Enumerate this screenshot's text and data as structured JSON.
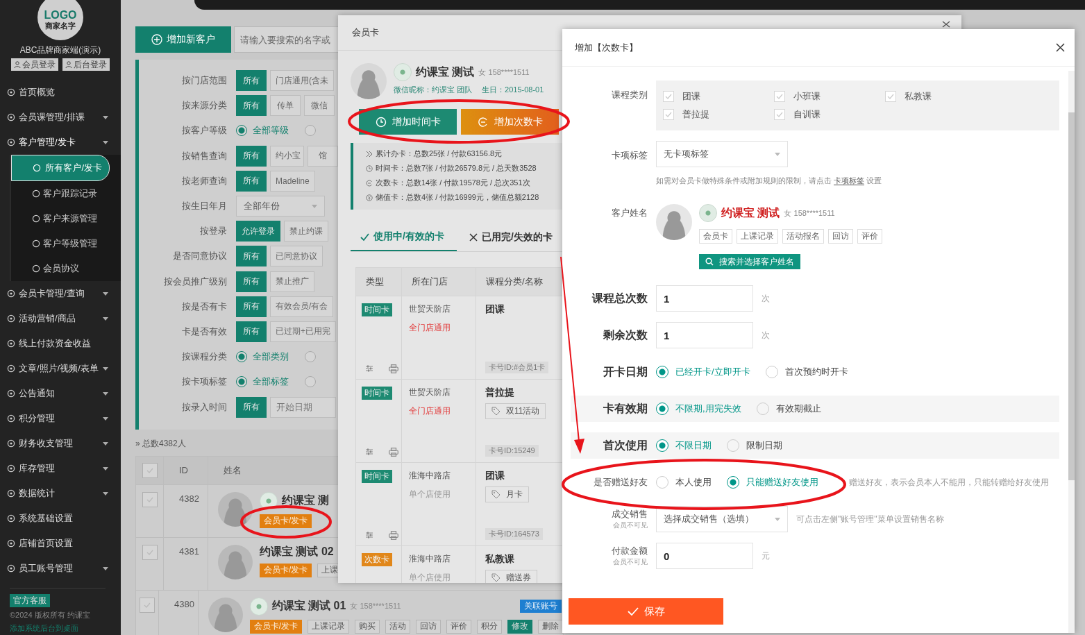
{
  "sidebar": {
    "logo_title": "LOGO",
    "logo_subtitle": "商家名字",
    "brand": "ABC品牌商家端(演示)",
    "login_buttons": [
      "会员登录",
      "后台登录"
    ],
    "items": [
      {
        "label": "首页概览",
        "kind": "link"
      },
      {
        "label": "会员课管理/排课",
        "kind": "group",
        "expanded": false
      },
      {
        "label": "客户管理/发卡",
        "kind": "group",
        "expanded": true,
        "children": [
          {
            "label": "所有客户/发卡",
            "selected": true
          },
          {
            "label": "客户跟踪记录",
            "selected": false
          },
          {
            "label": "客户来源管理",
            "selected": false
          },
          {
            "label": "客户等级管理",
            "selected": false
          },
          {
            "label": "会员协议",
            "selected": false
          }
        ]
      },
      {
        "label": "会员卡管理/查询",
        "kind": "group",
        "expanded": false
      },
      {
        "label": "活动营销/商品",
        "kind": "group",
        "expanded": false
      },
      {
        "label": "线上付款资金收益",
        "kind": "link"
      },
      {
        "label": "文章/照片/视频/表单",
        "kind": "group",
        "expanded": false
      },
      {
        "label": "公告通知",
        "kind": "group",
        "expanded": false
      },
      {
        "label": "积分管理",
        "kind": "group",
        "expanded": false
      },
      {
        "label": "财务收支管理",
        "kind": "group",
        "expanded": false
      },
      {
        "label": "库存管理",
        "kind": "group",
        "expanded": false
      },
      {
        "label": "数据统计",
        "kind": "group",
        "expanded": false
      },
      {
        "label": "系统基础设置",
        "kind": "link"
      },
      {
        "label": "店铺首页设置",
        "kind": "link"
      },
      {
        "label": "员工账号管理",
        "kind": "group",
        "expanded": false
      }
    ],
    "support_badge": "官方客服",
    "copyright": "©2024 版权所有 约课宝",
    "desktop_link": "添加系统后台到桌面"
  },
  "toolbar": {
    "add_button": "增加新客户",
    "search": {
      "placeholder": "请输入要搜索的名字或"
    }
  },
  "filters": [
    {
      "label": "按门店范围",
      "kind": "buttons",
      "options": [
        {
          "label": "所有",
          "selected": true
        },
        {
          "label": "门店通用(含未",
          "selected": false
        }
      ]
    },
    {
      "label": "按来源分类",
      "kind": "buttons",
      "options": [
        {
          "label": "所有",
          "selected": true
        },
        {
          "label": "传单",
          "selected": false
        },
        {
          "label": "微信",
          "selected": false
        }
      ]
    },
    {
      "label": "按客户等级",
      "kind": "radios",
      "options": [
        {
          "label": "全部等级",
          "selected": true
        },
        {
          "selected": false
        }
      ]
    },
    {
      "label": "按销售查询",
      "kind": "buttons",
      "options": [
        {
          "label": "所有",
          "selected": true
        },
        {
          "label": "约小宝",
          "selected": false
        },
        {
          "label": "馆",
          "selected": false
        }
      ]
    },
    {
      "label": "按老师查询",
      "kind": "buttons",
      "options": [
        {
          "label": "所有",
          "selected": true
        },
        {
          "label": "Madeline",
          "selected": false
        }
      ]
    },
    {
      "label": "按生日年月",
      "kind": "select",
      "value": "全部年份"
    },
    {
      "label": "按登录",
      "kind": "buttons",
      "options": [
        {
          "label": "允许登录",
          "selected": true
        },
        {
          "label": "禁止约课",
          "selected": false
        }
      ]
    },
    {
      "label": "是否同意协议",
      "kind": "buttons",
      "options": [
        {
          "label": "所有",
          "selected": true
        },
        {
          "label": "已同意协议",
          "selected": false
        }
      ]
    },
    {
      "label": "按会员推广级别",
      "kind": "buttons",
      "options": [
        {
          "label": "所有",
          "selected": true
        },
        {
          "label": "禁止推广",
          "selected": false
        }
      ]
    },
    {
      "label": "按是否有卡",
      "kind": "buttons",
      "options": [
        {
          "label": "所有",
          "selected": true
        },
        {
          "label": "有效会员/有会",
          "selected": false
        }
      ]
    },
    {
      "label": "卡是否有效",
      "kind": "buttons",
      "options": [
        {
          "label": "所有",
          "selected": true
        },
        {
          "label": "已过期+已用完",
          "selected": false
        }
      ]
    },
    {
      "label": "按课程分类",
      "kind": "radios",
      "options": [
        {
          "label": "全部类别",
          "selected": true
        },
        {
          "selected": false
        }
      ]
    },
    {
      "label": "按卡项标签",
      "kind": "radios",
      "options": [
        {
          "label": "全部标签",
          "selected": true
        },
        {
          "selected": false
        }
      ]
    },
    {
      "label": "按录入时间",
      "kind": "buttons",
      "options": [
        {
          "label": "所有",
          "selected": true
        }
      ],
      "date_field": {
        "placeholder": "开始日期"
      }
    }
  ],
  "total_count": "» 总数4382人",
  "customers": {
    "header_checked": false,
    "columns": [
      "ID",
      "姓名"
    ],
    "rows": [
      {
        "id": "4382",
        "checked": false,
        "brand_badge": true,
        "name": "约课宝 测",
        "actions": [
          {
            "label": "会员卡/发卡",
            "kind": "card"
          }
        ]
      },
      {
        "id": "4381",
        "checked": false,
        "brand_badge": false,
        "name": "约课宝 测试 02",
        "actions": [
          {
            "label": "会员卡/发卡",
            "kind": "card"
          },
          {
            "label": "上课",
            "kind": "plain"
          }
        ]
      },
      {
        "id": "4380",
        "checked": false,
        "brand_badge": true,
        "name": "约课宝 测试 01",
        "gender_phone": "女 158****1511",
        "link_tag": "关联账号",
        "actions": [
          {
            "label": "会员卡/发卡",
            "kind": "card"
          },
          {
            "label": "上课记录",
            "kind": "plain"
          },
          {
            "label": "购买",
            "kind": "plain"
          },
          {
            "label": "活动",
            "kind": "plain"
          },
          {
            "label": "回访",
            "kind": "plain"
          },
          {
            "label": "评价",
            "kind": "plain"
          },
          {
            "label": "积分",
            "kind": "plain"
          },
          {
            "label": "修改",
            "kind": "edit"
          },
          {
            "label": "删除",
            "kind": "plain"
          }
        ]
      }
    ]
  },
  "member_card_dialog": {
    "title": "会员卡",
    "customer": {
      "name": "约课宝 测试",
      "gender_phone": "女 158****1511",
      "wechat_nickname": "微信昵称：约课宝 团队",
      "birthday": "生日：2015-08-01"
    },
    "buttons": [
      {
        "label": "增加时间卡",
        "kind": "time"
      },
      {
        "label": "增加次数卡",
        "kind": "count"
      }
    ],
    "stats": [
      {
        "kind": "total",
        "text": "累计办卡：总数25张 / 付款63156.8元"
      },
      {
        "kind": "time",
        "text": "时间卡：总数7张 / 付款26579.8元 / 总天数3528"
      },
      {
        "kind": "count",
        "text": "次数卡：总数14张 / 付款19578元 / 总次351次"
      },
      {
        "kind": "stored",
        "text": "储值卡：总数4张 / 付款16999元，储值总额2128"
      }
    ],
    "tabs": [
      {
        "label": "使用中/有效的卡",
        "selected": true
      },
      {
        "label": "已用完/失效的卡",
        "selected": false
      }
    ],
    "cards": {
      "columns": [
        "类型",
        "所在门店",
        "课程分类/名称"
      ],
      "rows": [
        {
          "kind": "time",
          "type": "时间卡",
          "store": "世贸天阶店",
          "scope": {
            "label": "全门店通用",
            "kind": "all"
          },
          "course": "团课",
          "card_id": "卡号ID:#会员1卡"
        },
        {
          "kind": "time",
          "type": "时间卡",
          "store": "世贸天阶店",
          "scope": {
            "label": "全门店通用",
            "kind": "all"
          },
          "course": "普拉提",
          "tag": "双11活动",
          "card_id": "卡号ID:15249"
        },
        {
          "kind": "time",
          "type": "时间卡",
          "store": "淮海中路店",
          "scope": {
            "label": "单个店使用",
            "kind": "single"
          },
          "course": "团课",
          "tag": "月卡",
          "card_id": "卡号ID:164573"
        },
        {
          "kind": "count",
          "type": "次数卡",
          "store": "淮海中路店",
          "scope": {
            "label": "单个店使用",
            "kind": "single"
          },
          "course": "私教课",
          "tag": "赠送券"
        }
      ]
    }
  },
  "add_count_card": {
    "title": "增加【次数卡】",
    "course_types": {
      "label": "课程类别",
      "options": [
        {
          "label": "团课",
          "checked": false
        },
        {
          "label": "小班课",
          "checked": false
        },
        {
          "label": "私教课",
          "checked": false
        },
        {
          "label": "普拉提",
          "checked": false
        },
        {
          "label": "自训课",
          "checked": false
        }
      ]
    },
    "card_tag": {
      "label": "卡项标签",
      "value": "无卡项标签",
      "help_before": "如需对会员卡做特殊条件或附加规则的限制，请点击",
      "help_link": "卡项标签",
      "help_after": "设置"
    },
    "customer": {
      "label": "客户姓名",
      "name": "约课宝 测试",
      "gender_phone": "女 158****1511",
      "links": [
        "会员卡",
        "上课记录",
        "活动报名",
        "回访",
        "评价"
      ],
      "search_button": "搜索并选择客户姓名"
    },
    "counts": [
      {
        "label": "课程总次数",
        "value": "1",
        "unit": "次"
      },
      {
        "label": "剩余次数",
        "value": "1",
        "unit": "次"
      }
    ],
    "radio_groups": [
      {
        "label": "开卡日期",
        "kind": "major",
        "shaded": false,
        "options": [
          {
            "label": "已经开卡/立即开卡",
            "selected": true
          },
          {
            "label": "首次预约时开卡",
            "selected": false
          }
        ]
      },
      {
        "label": "卡有效期",
        "kind": "major",
        "shaded": true,
        "options": [
          {
            "label": "不限期,用完失效",
            "selected": true
          },
          {
            "label": "有效期截止",
            "selected": false
          }
        ]
      },
      {
        "label": "首次使用",
        "kind": "major",
        "shaded": true,
        "options": [
          {
            "label": "不限日期",
            "selected": true
          },
          {
            "label": "限制日期",
            "selected": false
          }
        ]
      },
      {
        "label": "是否赠送好友",
        "kind": "minor",
        "shaded": false,
        "options": [
          {
            "label": "本人使用",
            "selected": false
          },
          {
            "label": "只能赠送好友使用",
            "selected": true
          }
        ],
        "hint": "赠送好友，表示会员本人不能用，只能转赠给好友使用"
      }
    ],
    "sales": {
      "label": "成交销售",
      "sublabel": "会员不可见",
      "value": "选择成交销售（选填）",
      "hint": "可点击左侧\"账号管理\"菜单设置销售名称"
    },
    "payment": {
      "label": "付款金额",
      "sublabel": "会员不可见",
      "value": "0",
      "unit": "元"
    },
    "save_button": "保存"
  }
}
